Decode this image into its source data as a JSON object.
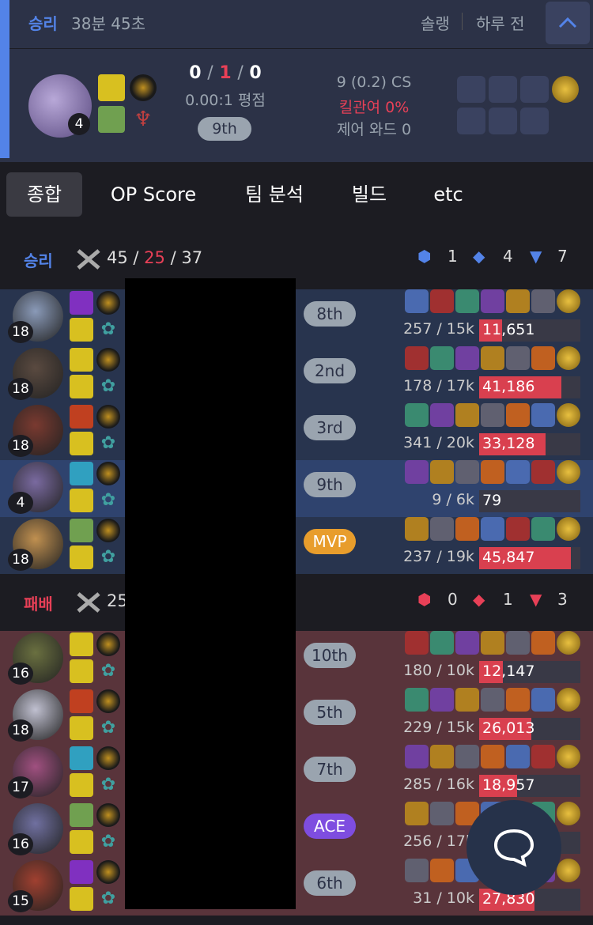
{
  "match": {
    "result": "승리",
    "duration": "38분 45초",
    "queue": "솔랭",
    "time_ago": "하루 전",
    "kda": {
      "k": "0",
      "d": "1",
      "a": "0"
    },
    "ratio": "0.00:1 평점",
    "placement": "9th",
    "level": "4",
    "cs": "9 (0.2) CS",
    "kill_participation": "킬관여 0%",
    "wards": "제어 와드 0"
  },
  "tabs": [
    "종합",
    "OP Score",
    "팀 분석",
    "빌드",
    "etc"
  ],
  "teams": [
    {
      "result": "승리",
      "color": "#5383e8",
      "k": "45",
      "d": "25",
      "a": "37",
      "objectives": [
        "1",
        "4",
        "7"
      ],
      "players": [
        {
          "level": "18",
          "place": "8th",
          "badge": "",
          "cs": "257 / 15k",
          "dmg": "11,651",
          "pct": 0.25,
          "bg": "win",
          "portrait": "#8a9ab8"
        },
        {
          "level": "18",
          "place": "2nd",
          "badge": "",
          "cs": "178 / 17k",
          "dmg": "41,186",
          "pct": 0.9,
          "bg": "win",
          "portrait": "#5a4a40"
        },
        {
          "level": "18",
          "place": "3rd",
          "badge": "",
          "cs": "341 / 20k",
          "dmg": "33,128",
          "pct": 0.72,
          "bg": "win",
          "portrait": "#7a3a30"
        },
        {
          "level": "4",
          "place": "9th",
          "badge": "",
          "cs": "9 / 6k",
          "dmg": "79",
          "pct": 0.0,
          "bg": "winme",
          "portrait": "#7a6aa0"
        },
        {
          "level": "18",
          "place": "MVP",
          "badge": "mvp",
          "cs": "237 / 19k",
          "dmg": "45,847",
          "pct": 1.0,
          "bg": "win",
          "portrait": "#c09050"
        }
      ]
    },
    {
      "result": "패배",
      "color": "#e84057",
      "k": "25",
      "d": "",
      "a": "",
      "objectives": [
        "0",
        "1",
        "3"
      ],
      "players": [
        {
          "level": "16",
          "place": "10th",
          "badge": "",
          "cs": "180 / 10k",
          "dmg": "12,147",
          "pct": 0.26,
          "bg": "lose",
          "portrait": "#6a7040"
        },
        {
          "level": "18",
          "place": "5th",
          "badge": "",
          "cs": "229 / 15k",
          "dmg": "26,013",
          "pct": 0.57,
          "bg": "lose",
          "portrait": "#c0c0d0"
        },
        {
          "level": "17",
          "place": "7th",
          "badge": "",
          "cs": "285 / 16k",
          "dmg": "18,957",
          "pct": 0.41,
          "bg": "lose",
          "portrait": "#a05080"
        },
        {
          "level": "16",
          "place": "ACE",
          "badge": "ace",
          "cs": "256 / 17k",
          "dmg": "",
          "pct": 0.0,
          "bg": "lose",
          "portrait": "#7070a0"
        },
        {
          "level": "15",
          "place": "6th",
          "badge": "",
          "cs": "31 / 10k",
          "dmg": "27,830",
          "pct": 0.6,
          "bg": "lose",
          "portrait": "#a04030"
        }
      ]
    }
  ]
}
